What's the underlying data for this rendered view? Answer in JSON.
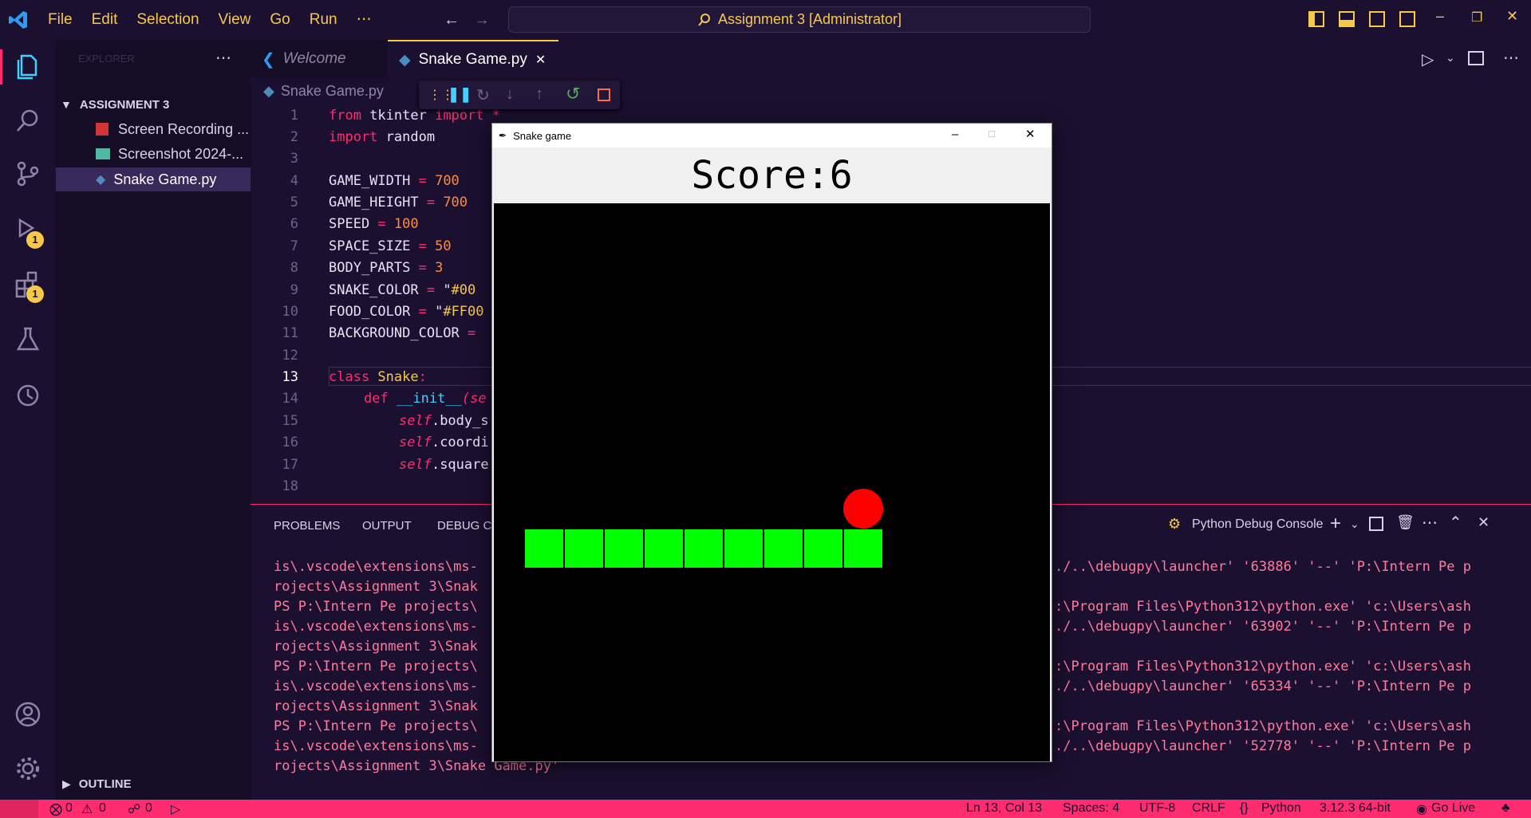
{
  "titlebar": {
    "menu": [
      "File",
      "Edit",
      "Selection",
      "View",
      "Go",
      "Run",
      "⋯"
    ],
    "title": "Assignment 3 [Administrator]"
  },
  "activity": {
    "run_badge": "1",
    "ext_badge": "1"
  },
  "sidebar": {
    "header": "EXPLORER",
    "folder": "ASSIGNMENT 3",
    "files": [
      "Screen Recording ...",
      "Screenshot 2024-...",
      "Snake Game.py"
    ],
    "outline": "OUTLINE"
  },
  "tabs": [
    {
      "label": "Welcome"
    },
    {
      "label": "Snake Game.py"
    }
  ],
  "breadcrumb": "Snake Game.py",
  "code_lines": [
    {
      "n": "1"
    },
    {
      "n": "2"
    },
    {
      "n": "3"
    },
    {
      "n": "4"
    },
    {
      "n": "5"
    },
    {
      "n": "6"
    },
    {
      "n": "7"
    },
    {
      "n": "8"
    },
    {
      "n": "9"
    },
    {
      "n": "10"
    },
    {
      "n": "11"
    },
    {
      "n": "12"
    },
    {
      "n": "13"
    },
    {
      "n": "14"
    },
    {
      "n": "15"
    },
    {
      "n": "16"
    },
    {
      "n": "17"
    },
    {
      "n": "18"
    }
  ],
  "code": {
    "l1": [
      "from",
      " tkinter ",
      "import",
      " *"
    ],
    "l2": [
      "import",
      " random"
    ],
    "l4": [
      "GAME_WIDTH ",
      "=",
      " 700"
    ],
    "l5": [
      "GAME_HEIGHT ",
      "=",
      " 700"
    ],
    "l6": [
      "SPEED ",
      "=",
      " 100"
    ],
    "l7": [
      "SPACE_SIZE ",
      "=",
      " 50"
    ],
    "l8": [
      "BODY_PARTS ",
      "=",
      " 3"
    ],
    "l9": [
      "SNAKE_COLOR ",
      "=",
      " \"",
      "#00"
    ],
    "l10": [
      "FOOD_COLOR ",
      "=",
      " \"",
      "#FF00"
    ],
    "l11": [
      "BACKGROUND_COLOR ",
      "="
    ],
    "l13": [
      "class",
      " Snake",
      ":"
    ],
    "l14": [
      "def",
      " __init__",
      "(se"
    ],
    "l15": [
      "self",
      ".body_s"
    ],
    "l16": [
      "self",
      ".coordi"
    ],
    "l17": [
      "self",
      ".square"
    ]
  },
  "panel": {
    "tabs": [
      "PROBLEMS",
      "OUTPUT",
      "DEBUG CO"
    ],
    "console": "Python Debug Console",
    "term_left": [
      "is\\.vscode\\extensions\\ms-",
      "rojects\\Assignment 3\\Snak",
      "PS P:\\Intern Pe projects\\",
      "is\\.vscode\\extensions\\ms-",
      "rojects\\Assignment 3\\Snak",
      "PS P:\\Intern Pe projects\\",
      "is\\.vscode\\extensions\\ms-",
      "rojects\\Assignment 3\\Snak",
      "PS P:\\Intern Pe projects\\",
      "is\\.vscode\\extensions\\ms-",
      "rojects\\Assignment 3\\Snake Game.py'"
    ],
    "term_right": [
      "./..\\debugpy\\launcher' '63886' '--' 'P:\\Intern Pe p",
      "",
      ":\\Program Files\\Python312\\python.exe' 'c:\\Users\\ash",
      "./..\\debugpy\\launcher' '63902' '--' 'P:\\Intern Pe p",
      "",
      ":\\Program Files\\Python312\\python.exe' 'c:\\Users\\ash",
      "./..\\debugpy\\launcher' '65334' '--' 'P:\\Intern Pe p",
      "",
      ":\\Program Files\\Python312\\python.exe' 'c:\\Users\\ash",
      "./..\\debugpy\\launcher' '52778' '--' 'P:\\Intern Pe p",
      ""
    ]
  },
  "status": {
    "errors": "0",
    "warnings": "0",
    "ports": "0",
    "position": "Ln 13, Col 13",
    "spaces": "Spaces: 4",
    "encoding": "UTF-8",
    "eol": "CRLF",
    "language": "Python",
    "interpreter": "3.12.3 64-bit",
    "golive": "Go Live"
  },
  "game": {
    "window_title": "Snake game",
    "score": "Score:6",
    "snake_color": "#00FF00",
    "food_color": "#FF0000",
    "background_color": "#000000",
    "grid_unit": 50,
    "snake_cells": [
      [
        0,
        8
      ],
      [
        1,
        8
      ],
      [
        2,
        8
      ],
      [
        3,
        8
      ],
      [
        4,
        8
      ],
      [
        5,
        8
      ],
      [
        6,
        8
      ],
      [
        7,
        8
      ],
      [
        8,
        8
      ]
    ],
    "food_cell": [
      8,
      7
    ]
  }
}
